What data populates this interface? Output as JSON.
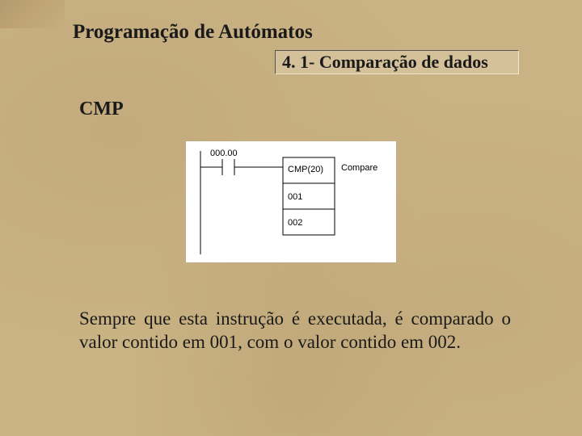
{
  "header": {
    "title": "Programação de Autómatos",
    "subtitle": "4. 1- Comparação de dados"
  },
  "section": {
    "heading": "CMP"
  },
  "diagram": {
    "rung_address": "000.00",
    "box_title": "CMP(20)",
    "box_title_side": "Compare",
    "operand1": "001",
    "operand2": "002"
  },
  "body": {
    "paragraph": "Sempre que esta instrução é executada, é comparado o valor contido em 001, com o valor contido em 002."
  }
}
